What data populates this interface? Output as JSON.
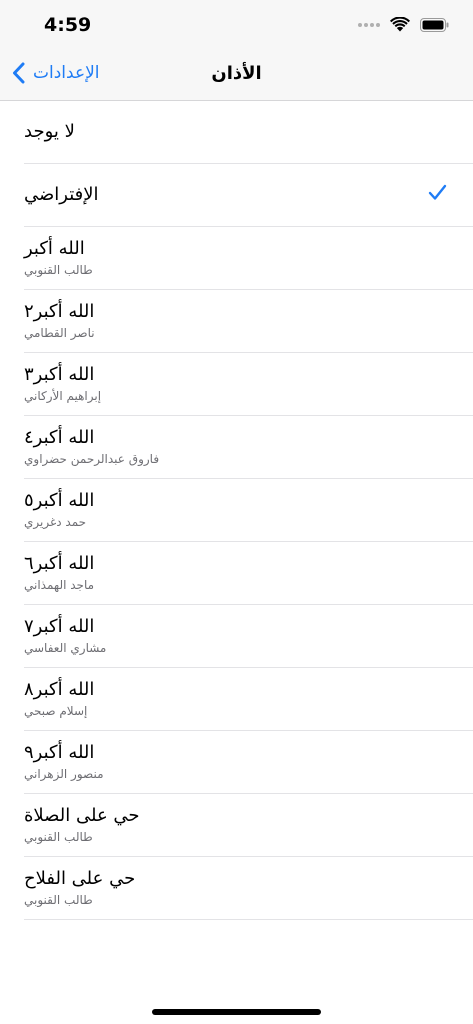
{
  "status_bar": {
    "time": "4:59"
  },
  "nav": {
    "back_label": "الإعدادات",
    "title": "الأذان"
  },
  "colors": {
    "accent": "#1f7cf5",
    "subtitle": "#6e6e73",
    "separator": "#e3e3e6"
  },
  "items": [
    {
      "title": "لا يوجد",
      "subtitle": "",
      "selected": false
    },
    {
      "title": "الإفتراضي",
      "subtitle": "",
      "selected": true
    },
    {
      "title": "الله أكبر",
      "subtitle": "طالب القنوبي",
      "selected": false
    },
    {
      "title": "الله أكبر٢",
      "subtitle": "ناصر القطامي",
      "selected": false
    },
    {
      "title": "الله أكبر٣",
      "subtitle": "إبراهيم الأركاني",
      "selected": false
    },
    {
      "title": "الله أكبر٤",
      "subtitle": "فاروق عبدالرحمن حضراوي",
      "selected": false
    },
    {
      "title": "الله أكبر٥",
      "subtitle": "حمد دغريري",
      "selected": false
    },
    {
      "title": "الله أكبر٦",
      "subtitle": "ماجد الهمذاني",
      "selected": false
    },
    {
      "title": "الله أكبر٧",
      "subtitle": "مشاري العفاسي",
      "selected": false
    },
    {
      "title": "الله أكبر٨",
      "subtitle": "إسلام صبحي",
      "selected": false
    },
    {
      "title": "الله أكبر٩",
      "subtitle": "منصور الزهراني",
      "selected": false
    },
    {
      "title": "حي على الصلاة",
      "subtitle": "طالب القنوبي",
      "selected": false
    },
    {
      "title": "حي على الفلاح",
      "subtitle": "طالب القنوبي",
      "selected": false
    }
  ]
}
